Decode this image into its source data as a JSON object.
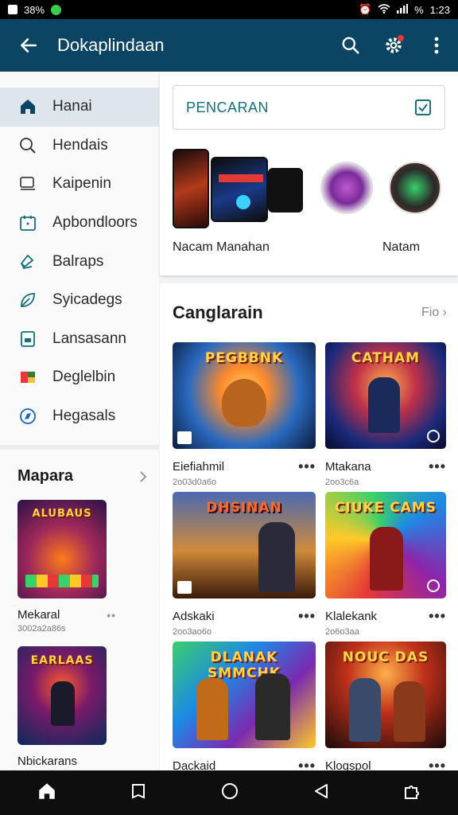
{
  "status": {
    "left_text": "38%",
    "time": "1:23",
    "battery": "%"
  },
  "appbar": {
    "title": "Dokaplindaan"
  },
  "sidebar": {
    "items": [
      {
        "label": "Hanai",
        "icon": "home-icon"
      },
      {
        "label": "Hendais",
        "icon": "search-icon"
      },
      {
        "label": "Kaipenin",
        "icon": "monitor-icon"
      },
      {
        "label": "Apbondloors",
        "icon": "calendar-icon"
      },
      {
        "label": "Balraps",
        "icon": "tag-icon"
      },
      {
        "label": "Syicadegs",
        "icon": "leaf-icon"
      },
      {
        "label": "Lansasann",
        "icon": "page-icon"
      },
      {
        "label": "Deglelbin",
        "icon": "puzzle-icon"
      },
      {
        "label": "Hegasals",
        "icon": "compass-icon"
      }
    ],
    "section_title": "Mapara",
    "cards": [
      {
        "title": "Mekaral",
        "sub": "3002a2a86s",
        "art": "ALUBAUS"
      },
      {
        "title": "Nbickarans",
        "sub": "",
        "art": "EARLAAS"
      }
    ]
  },
  "search": {
    "placeholder": "PENCARAN"
  },
  "featured": {
    "label_left": "Nacam Manahan",
    "label_right": "Natam"
  },
  "section": {
    "title": "Canglarain",
    "more": "Fio",
    "games": [
      {
        "title": "Eiefiahmil",
        "sub": "2o03d0a6o",
        "art": "PEGBBNK"
      },
      {
        "title": "Mtakana",
        "sub": "2oo3c6a",
        "art": "CATHAM"
      },
      {
        "title": "Adskaki",
        "sub": "2oo3ao6o",
        "art": "DHSINAN"
      },
      {
        "title": "Klalekank",
        "sub": "2o6o3aa",
        "art": "CIUKE CAMS"
      },
      {
        "title": "Dackaid",
        "sub": "",
        "art": "DLANAK SMMCHK"
      },
      {
        "title": "Klogspol",
        "sub": "",
        "art": "NOUC DAS"
      }
    ]
  },
  "colors": {
    "appbar": "#0b4563",
    "active_nav": "#dde6ec",
    "accent": "#16707a"
  }
}
